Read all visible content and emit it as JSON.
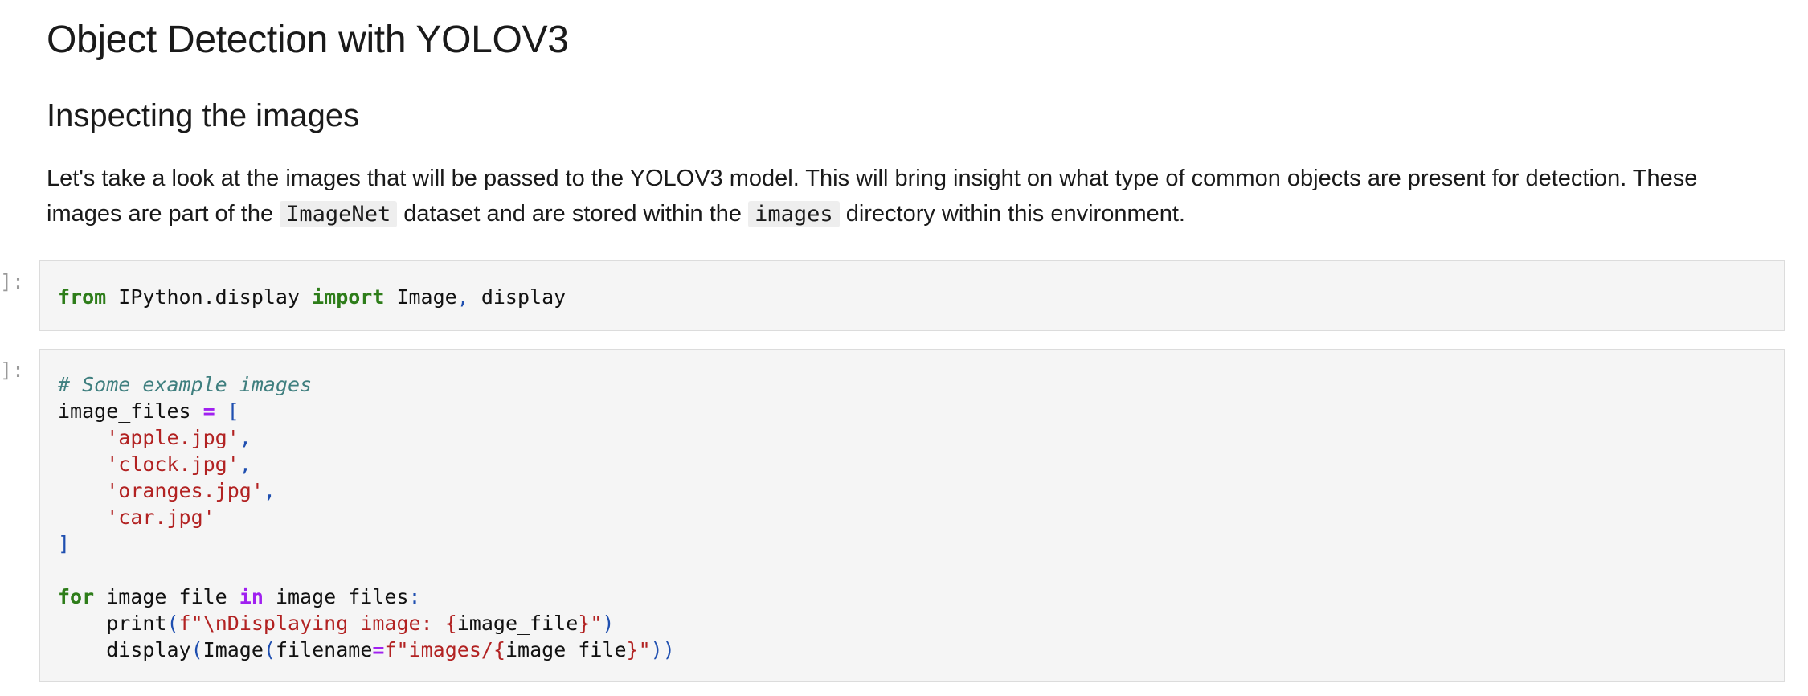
{
  "notebook": {
    "title": "Object Detection with YOLOV3",
    "subtitle": "Inspecting the images",
    "intro": {
      "line1": "Let's take a look at the images that will be passed to the YOLOV3 model. This will bring insight on what type of common objects are present for detection. These",
      "line2_before": "images are part of the ",
      "code1": "ImageNet",
      "line2_middle": " dataset and are stored within the ",
      "code2": "images",
      "line2_after": " directory within this environment."
    },
    "cells": [
      {
        "prompt": "]:",
        "code": {
          "kw_from": "from",
          "module": " IPython.display ",
          "kw_import": "import",
          "name1": " Image",
          "comma": ",",
          "name2": " display"
        }
      },
      {
        "prompt": "]:",
        "code": {
          "comment": "# Some example images",
          "var": "image_files",
          "assign": "=",
          "open_bracket": "[",
          "files": [
            "'apple.jpg'",
            "'clock.jpg'",
            "'oranges.jpg'",
            "'car.jpg'"
          ],
          "comma": ",",
          "close_bracket": "]",
          "kw_for": "for",
          "loop_var": " image_file ",
          "kw_in": "in",
          "iterable": " image_files",
          "colon": ":",
          "print_fn": "print",
          "print_fstr_prefix": "f",
          "print_str_a": "\"\\nDisplaying image: ",
          "print_brace_open": "{",
          "print_arg": "image_file",
          "print_brace_close": "}",
          "print_str_b": "\"",
          "paren_open": "(",
          "paren_close": ")",
          "display_fn": "display",
          "image_cls": "Image",
          "kwarg": "filename",
          "display_str_a": "\"images/",
          "display_close": "))"
        }
      }
    ]
  }
}
